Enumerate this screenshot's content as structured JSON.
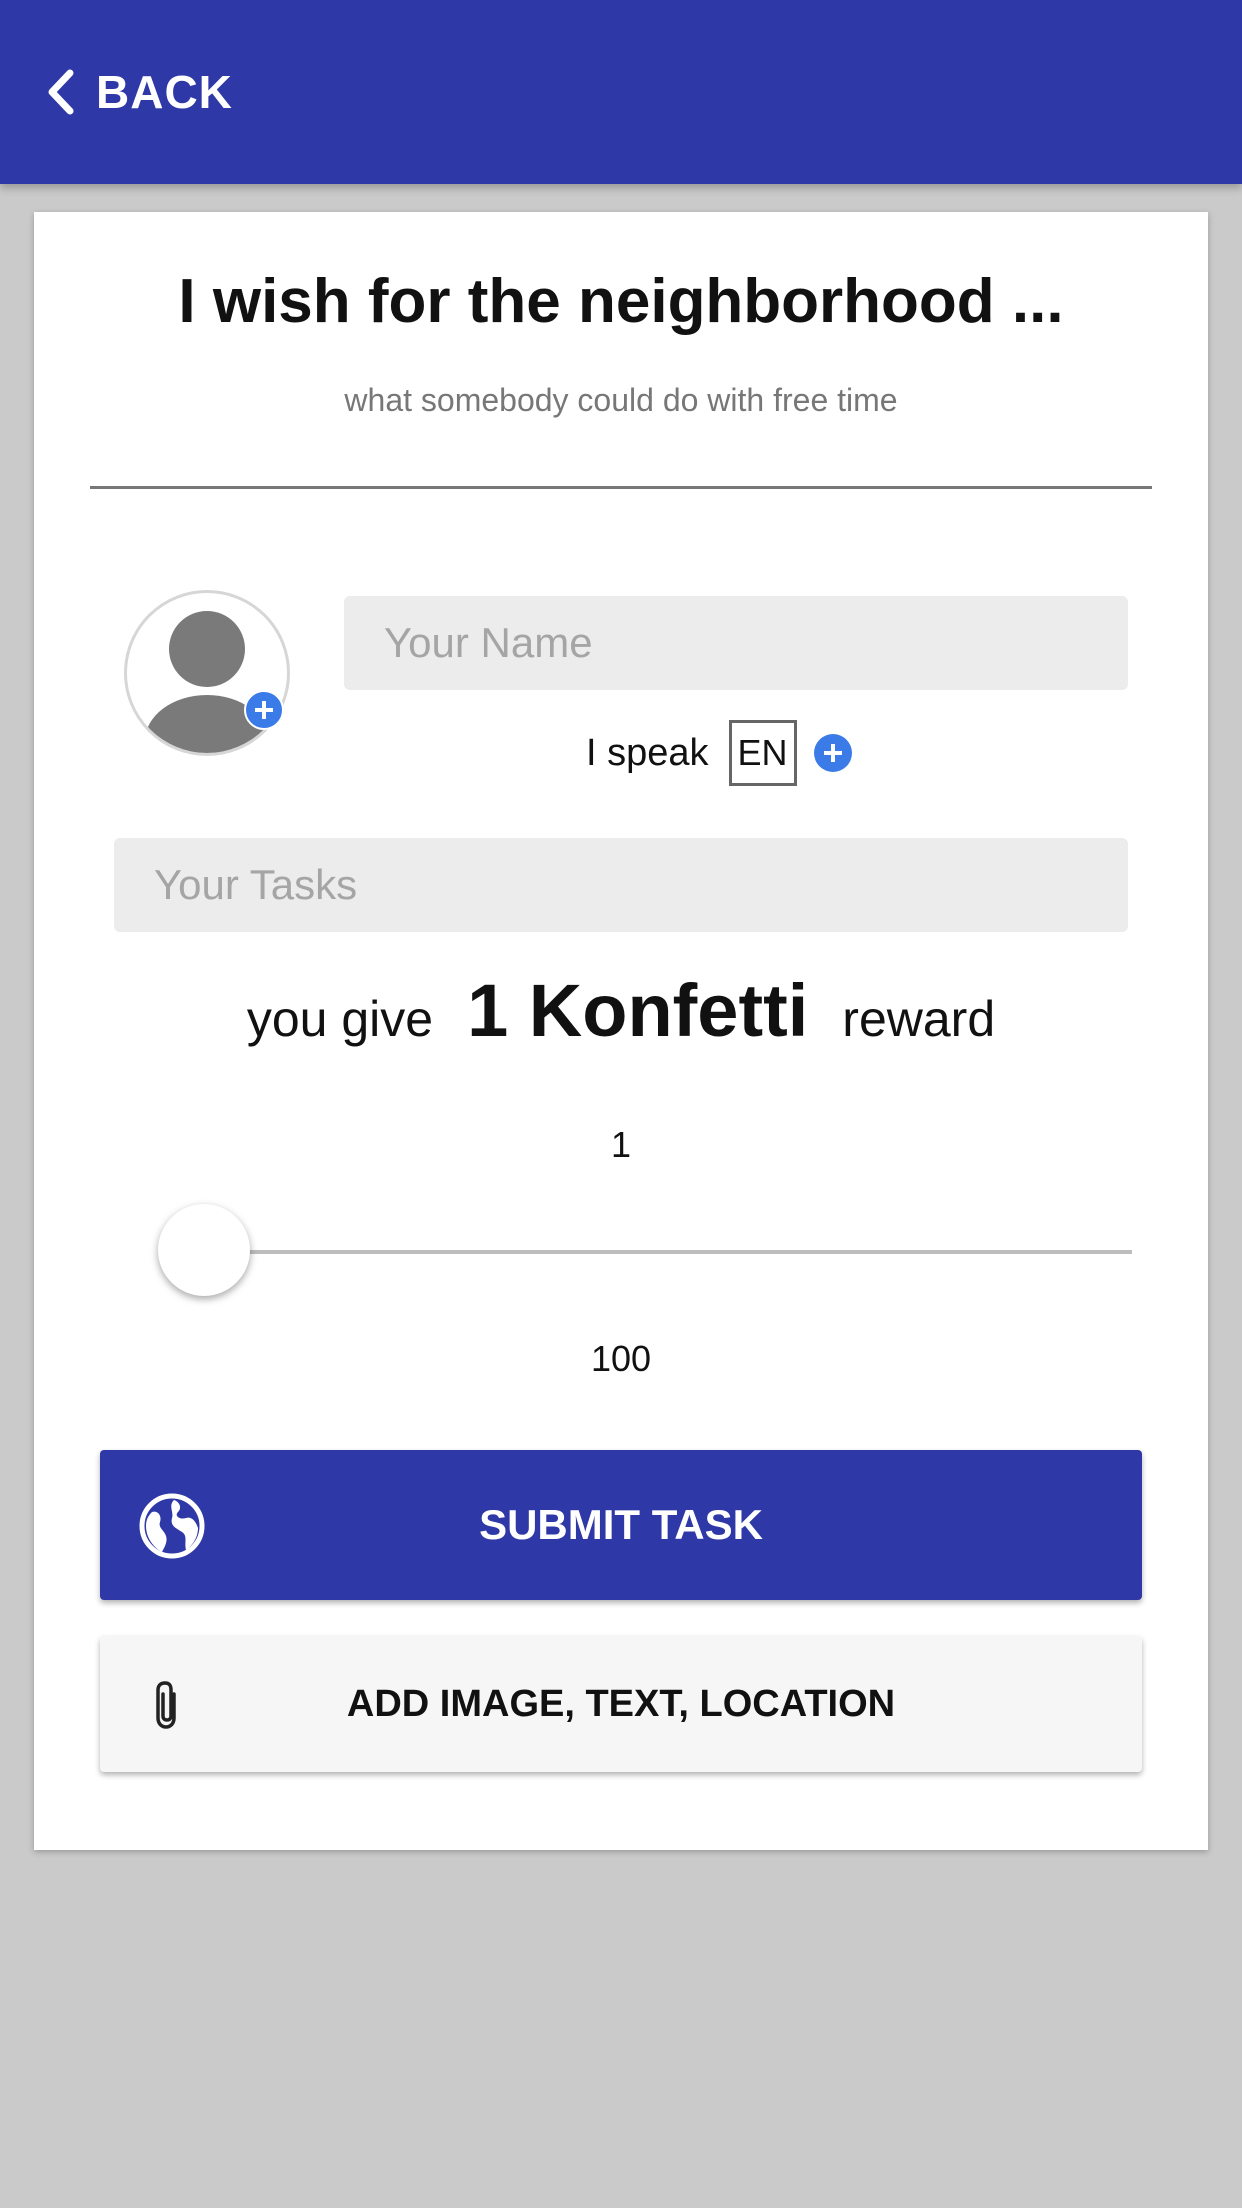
{
  "header": {
    "back_label": "BACK",
    "color": "#2f38a7"
  },
  "card": {
    "title": "I wish for the neighborhood ...",
    "subtitle": "what somebody could do with free time"
  },
  "profile": {
    "avatar_icon": "user-silhouette-icon",
    "add_photo_icon": "plus-circle-icon",
    "name_placeholder": "Your Name",
    "speak_label": "I speak",
    "language": "EN",
    "add_language_icon": "plus-circle-icon"
  },
  "tasks": {
    "placeholder": "Your Tasks"
  },
  "reward": {
    "prefix": "you give",
    "amount_text": "1 Konfetti",
    "suffix": "reward"
  },
  "slider": {
    "min_label": "1",
    "max_label": "100",
    "min": 1,
    "max": 100,
    "value": 1
  },
  "actions": {
    "submit_label": "SUBMIT TASK",
    "submit_icon": "globe-icon",
    "attach_label": "ADD IMAGE, TEXT, LOCATION",
    "attach_icon": "paperclip-icon",
    "accent": "#2f38a7",
    "badge_blue": "#3b7be8"
  }
}
